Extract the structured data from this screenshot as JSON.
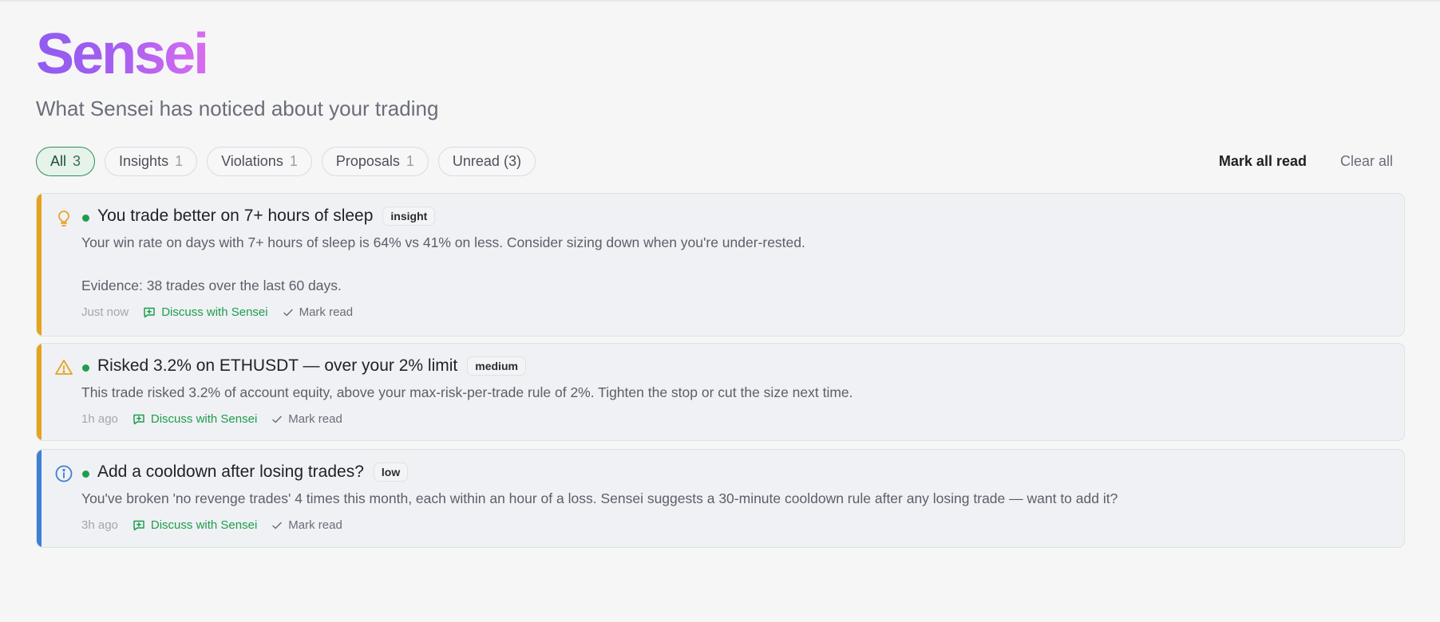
{
  "app": {
    "logo": "Sensei",
    "subtitle": "What Sensei has noticed about your trading"
  },
  "filters": [
    {
      "label": "All",
      "count": "3",
      "active": true
    },
    {
      "label": "Insights",
      "count": "1"
    },
    {
      "label": "Violations",
      "count": "1"
    },
    {
      "label": "Proposals",
      "count": "1"
    },
    {
      "label": "Unread (3)",
      "count": ""
    }
  ],
  "actions": {
    "mark_all_read": "Mark all read",
    "clear_all": "Clear all"
  },
  "notifications": [
    {
      "kind": "insight",
      "icon": "lightbulb-icon",
      "accent": "#e8a21d",
      "title": "You trade better on 7+ hours of sleep",
      "badge": "insight",
      "body": "Your win rate on days with 7+ hours of sleep is 64% vs 41% on less. Consider sizing down when you're under-rested.\n\nEvidence: 38 trades over the last 60 days.",
      "time": "Just now",
      "discuss_label": "Discuss with Sensei",
      "mark_read_label": "Mark read",
      "unread": true
    },
    {
      "kind": "violation",
      "icon": "warning-triangle-icon",
      "accent": "#e8a21d",
      "title": "Risked 3.2% on ETHUSDT — over your 2% limit",
      "badge": "medium",
      "body": "This trade risked 3.2% of account equity, above your max-risk-per-trade rule of 2%. Tighten the stop or cut the size next time.",
      "time": "1h ago",
      "discuss_label": "Discuss with Sensei",
      "mark_read_label": "Mark read",
      "unread": true
    },
    {
      "kind": "proposal",
      "icon": "info-circle-icon",
      "accent": "#3f7fd6",
      "title": "Add a cooldown after losing trades?",
      "badge": "low",
      "body": "You've broken 'no revenge trades' 4 times this month, each within an hour of a loss. Sensei suggests a 30-minute cooldown rule after any losing trade — want to add it?",
      "time": "3h ago",
      "discuss_label": "Discuss with Sensei",
      "mark_read_label": "Mark read",
      "unread": true
    }
  ]
}
